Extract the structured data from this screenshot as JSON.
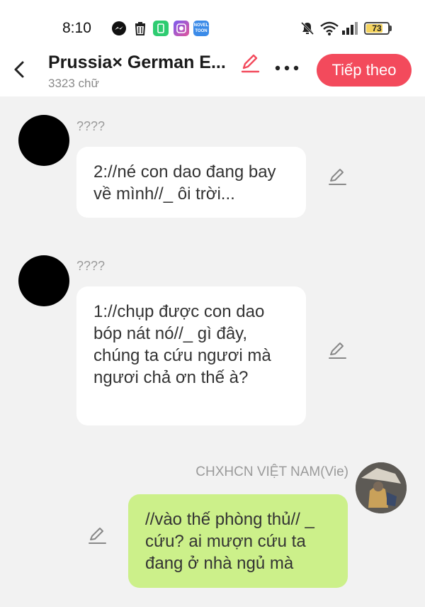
{
  "status_bar": {
    "time": "8:10",
    "battery": "73",
    "battery_level": 0.73,
    "icons": [
      "messenger-icon",
      "trash-icon",
      "app-icon",
      "app-icon",
      "novel-toon-app-icon",
      "mute-icon",
      "wifi-icon",
      "signal-icon",
      "battery-icon"
    ],
    "app3_label": "NOVEL TOON"
  },
  "header": {
    "title": "Prussia× German E...",
    "subtitle": "3323 chữ",
    "next_label": "Tiếp theo",
    "accent_color": "#f34a5c"
  },
  "messages": [
    {
      "sender": "????",
      "text": "2://né con dao đang bay về mình//_ ôi trời...",
      "mine": false
    },
    {
      "sender": "????",
      "text": "1://chụp được con dao bóp nát nó//_ gì đây, chúng ta cứu ngươi mà ngươi chả ơn thế à?",
      "mine": false
    },
    {
      "sender": "CHXHCN VIỆT NAM(Vie)",
      "text": "//vào thế phòng thủ// _ cứu? ai mượn cứu ta đang ở nhà ngủ mà",
      "mine": true
    }
  ],
  "colors": {
    "mine_bubble": "#ccf08a",
    "other_bubble": "#ffffff",
    "background": "#f2f2f2"
  }
}
